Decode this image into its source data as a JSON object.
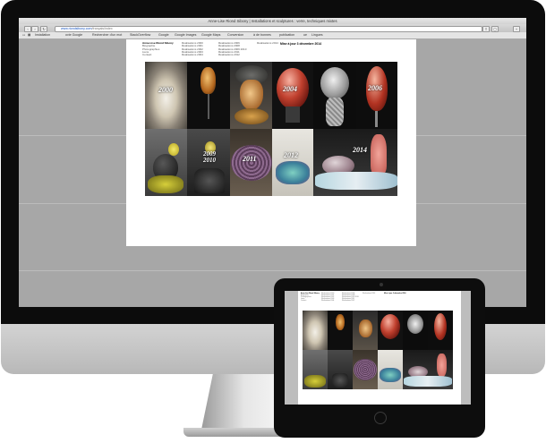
{
  "browser": {
    "title": "Anne-Lise Riond Sibony | Installations et sculptures : verre, techniques mixtes",
    "url_host": "www.riondsibony.com",
    "url_path": "/français/index",
    "bookmarks": [
      "Installation",
      "ovie Google",
      "Rechercher d'un mot",
      "StackOverflow",
      "Google",
      "Google Images",
      "Google Maps",
      "Conversion",
      "à de bonnes",
      "publication",
      "ue",
      "Lingues"
    ]
  },
  "site": {
    "brand": "Anne-Lise Riond Sibony",
    "nav_col1": [
      "Biographie",
      "Photographies",
      "Liens",
      "Contact"
    ],
    "nav_col2": [
      "Réalisations 2000",
      "Réalisations 2001",
      "Réalisations 2002",
      "Réalisations 2003",
      "Réalisations 2004"
    ],
    "nav_col3": [
      "Réalisations 2006",
      "Réalisations 2008",
      "Réalisations 2009 2010",
      "Réalisations 2011",
      "Réalisations 2012"
    ],
    "nav_col4": [
      "Réalisations 2014"
    ],
    "update_notice": "Mise à jour 3 décembre 2014",
    "years": [
      "2000",
      "2004",
      "2006",
      "2009 2010",
      "2011",
      "2012",
      "2014"
    ]
  },
  "colors": {
    "bezel": "#0c0c0c",
    "screen_bg": "#a7a7a7",
    "traffic_red": "#e0443e",
    "traffic_yellow": "#dea123",
    "traffic_green": "#1aab29"
  }
}
